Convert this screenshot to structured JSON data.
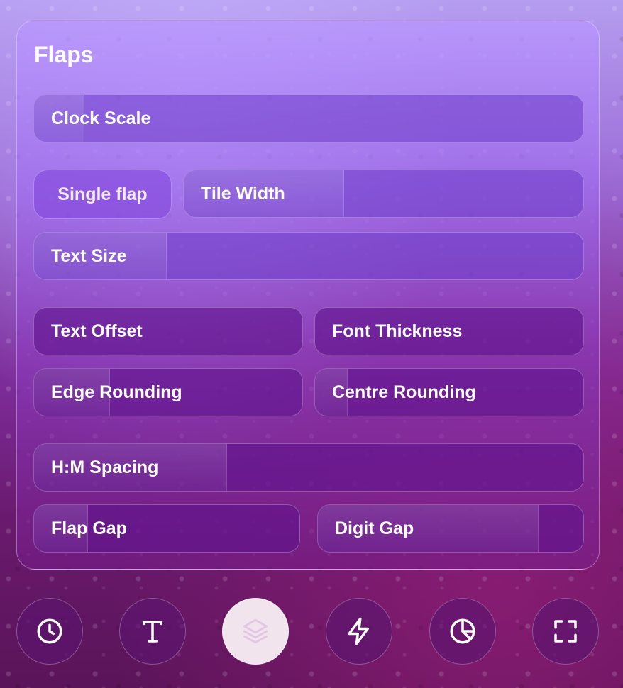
{
  "panel": {
    "title": "Flaps"
  },
  "controls": {
    "clock_scale": {
      "label": "Clock Scale",
      "value": 0.09
    },
    "single_flap": {
      "label": "Single flap"
    },
    "tile_width": {
      "label": "Tile Width",
      "value": 0.4
    },
    "text_size": {
      "label": "Text Size",
      "value": 0.24
    },
    "text_offset": {
      "label": "Text Offset",
      "value": 0.0
    },
    "font_thickness": {
      "label": "Font Thickness",
      "value": 0.0
    },
    "edge_rounding": {
      "label": "Edge Rounding",
      "value": 0.28
    },
    "centre_rounding": {
      "label": "Centre Rounding",
      "value": 0.12
    },
    "hm_spacing": {
      "label": "H:M Spacing",
      "value": 0.35
    },
    "flap_gap": {
      "label": "Flap Gap",
      "value": 0.2
    },
    "digit_gap": {
      "label": "Digit Gap",
      "value": 0.83
    }
  },
  "nav": {
    "items": [
      {
        "icon": "clock-icon",
        "active": false
      },
      {
        "icon": "text-icon",
        "active": false
      },
      {
        "icon": "layers-icon",
        "active": true
      },
      {
        "icon": "lightning-icon",
        "active": false
      },
      {
        "icon": "pie-chart-icon",
        "active": false
      },
      {
        "icon": "fullscreen-icon",
        "active": false
      }
    ]
  },
  "colors": {
    "active_nav_bg": "#f1e4ec",
    "active_icon": "#e7cfe9",
    "icon": "#ffffff"
  }
}
